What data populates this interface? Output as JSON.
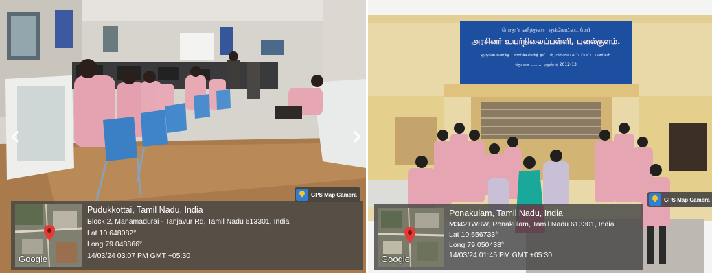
{
  "photos": [
    {
      "gps": {
        "badge_label": "GPS Map Camera",
        "place": "Pudukkottai, Tamil Nadu, India",
        "address": "Block 2, Manamadurai - Tanjavur Rd, Tamil Nadu 613301, India",
        "lat": "Lat 10.648082°",
        "long": "Long 79.048866°",
        "timestamp": "14/03/24 03:07 PM GMT +05:30",
        "map_logo": "Google"
      },
      "nav": {
        "prev_icon": "‹",
        "next_icon": "›"
      }
    },
    {
      "sign": {
        "line1": "பொதுப்பணித்துறை புதுக்கோட்டை (மா)",
        "line2": "அரசினர் உயர்நிலைப்பள்ளி, புனல்குளம்.",
        "line3": "ஒருங்கிணைந்த பள்ளிக்கல்வித் திட்டம், பிரிவில் கட்டப்பட்ட பணிகள்",
        "line4": "தொகை .........   ஆண்டு 2012-13"
      },
      "gps": {
        "badge_label": "GPS Map Camera",
        "place": "Ponakulam, Tamil Nadu, India",
        "address": "M342+W8W, Ponakulam, Tamil Nadu 613301, India",
        "lat": "Lat 10.656733°",
        "long": "Long 79.050438°",
        "timestamp": "14/03/24 01:45 PM GMT +05:30",
        "map_logo": "Google"
      }
    }
  ],
  "colors": {
    "uniform_shirt": "#e8a7b4",
    "chair_blue": "#3b7fc4",
    "sign_blue": "#1c4fa0",
    "building_wall": "#e9d9a8",
    "overlay": "#464646"
  }
}
